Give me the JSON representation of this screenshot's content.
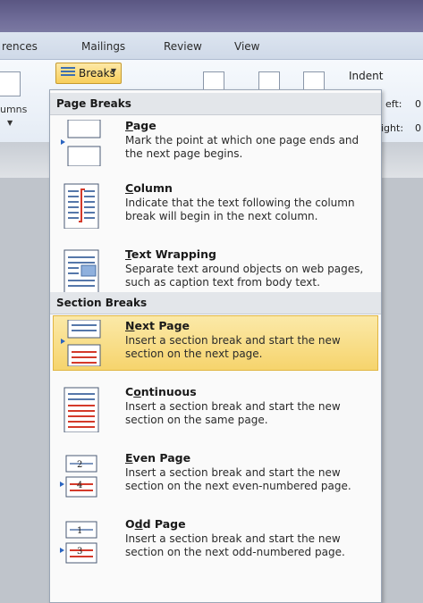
{
  "ribbon_tabs": [
    "rences",
    "Mailings",
    "Review",
    "View"
  ],
  "left_group_label": "umns",
  "breaks_button": {
    "label": "Breaks"
  },
  "indent_group": {
    "title": "Indent",
    "left_label": "eft:",
    "right_label": "ight:",
    "left_value": "0",
    "right_value": "0"
  },
  "menu": {
    "page_breaks_header": "Page Breaks",
    "section_breaks_header": "Section Breaks",
    "items": [
      {
        "mnemonic": "P",
        "rest": "age",
        "description": "Mark the point at which one page ends and the next page begins.",
        "icon": "page-break-icon"
      },
      {
        "mnemonic": "C",
        "rest": "olumn",
        "description": "Indicate that the text following the column break will begin in the next column.",
        "icon": "column-break-icon"
      },
      {
        "mnemonic": "T",
        "rest": "ext Wrapping",
        "description": "Separate text around objects on web pages, such as caption text from body text.",
        "icon": "text-wrapping-icon"
      },
      {
        "mnemonic": "N",
        "rest": "ext Page",
        "description": "Insert a section break and start the new section on the next page.",
        "icon": "next-page-icon"
      },
      {
        "pre": "C",
        "mnemonic": "o",
        "rest": "ntinuous",
        "description": "Insert a section break and start the new section on the same page.",
        "icon": "continuous-icon"
      },
      {
        "mnemonic": "E",
        "rest": "ven Page",
        "description": "Insert a section break and start the new section on the next even-numbered page.",
        "icon": "even-page-icon",
        "page_numbers": [
          "2",
          "4"
        ]
      },
      {
        "pre": "O",
        "mnemonic": "d",
        "rest": "d Page",
        "description": "Insert a section break and start the new section on the next odd-numbered page.",
        "icon": "odd-page-icon",
        "page_numbers": [
          "1",
          "3"
        ]
      }
    ]
  }
}
